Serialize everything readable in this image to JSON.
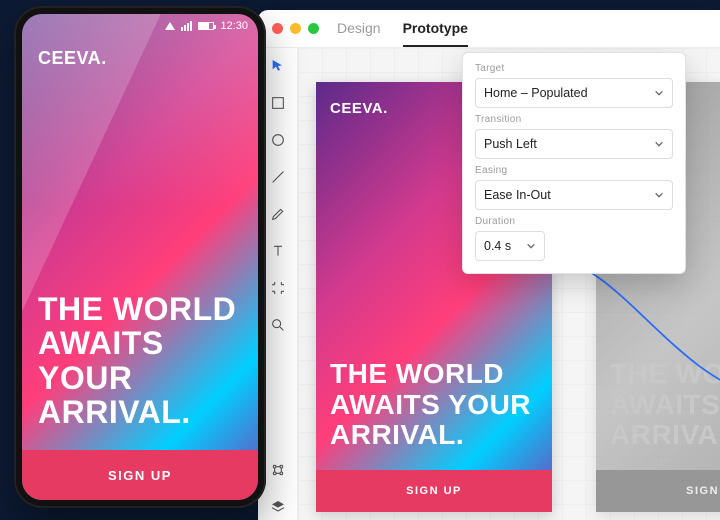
{
  "phone": {
    "status_time": "12:30",
    "brand": "CEEVA",
    "headline_l1": "THE WORLD",
    "headline_l2": "AWAITS YOUR",
    "headline_l3": "ARRIVAL.",
    "cta": "SIGN UP"
  },
  "app": {
    "tabs": {
      "design": "Design",
      "prototype": "Prototype"
    },
    "popover": {
      "target_label": "Target",
      "target_value": "Home – Populated",
      "transition_label": "Transition",
      "transition_value": "Push Left",
      "easing_label": "Easing",
      "easing_value": "Ease In-Out",
      "duration_label": "Duration",
      "duration_value": "0.4 s"
    },
    "artboard": {
      "brand": "CEEVA",
      "headline_l1": "THE WORLD",
      "headline_l2": "AWAITS YOUR",
      "headline_l3": "ARRIVAL.",
      "cta": "SIGN UP"
    },
    "artboard2": {
      "headline_l1": "THE WOR",
      "headline_l2": "AWAITS Y",
      "headline_l3": "ARRIVAL.",
      "cta": "SIGN UP"
    }
  }
}
